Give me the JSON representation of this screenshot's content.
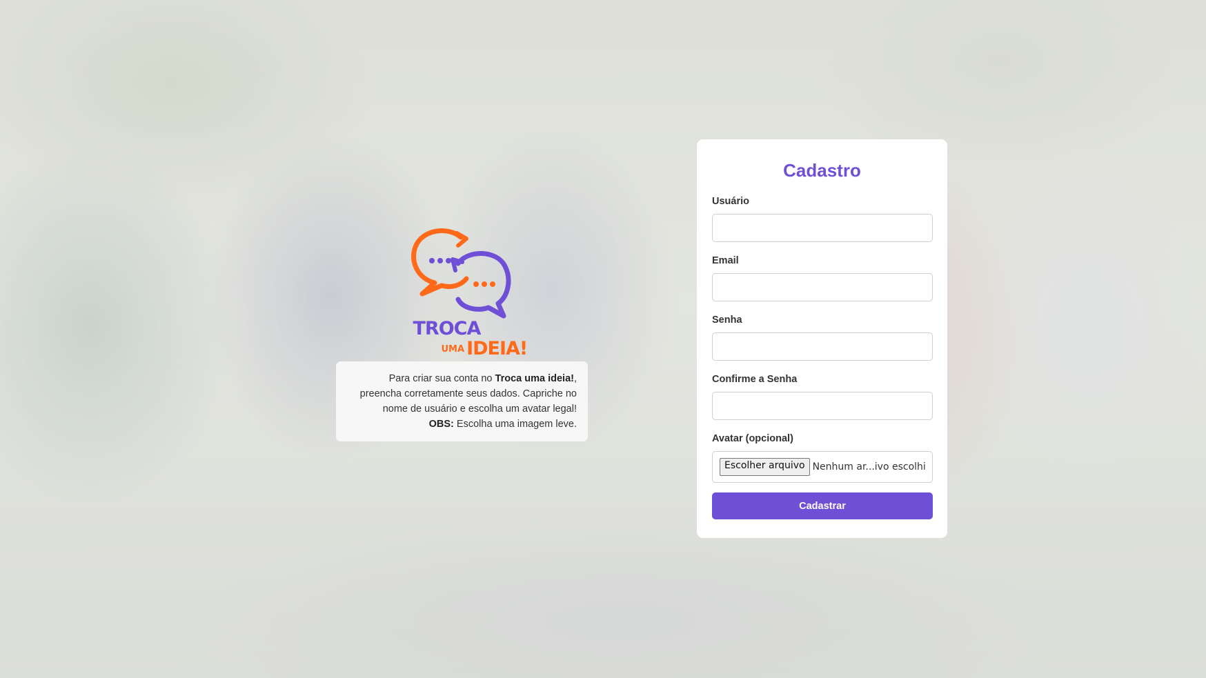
{
  "brand": {
    "logo_word_1": "TROCA",
    "logo_word_2": "UMA",
    "logo_word_3": "IDEIA!",
    "colors": {
      "primary": "#6f4fd6",
      "accent": "#ff6a1a"
    }
  },
  "info": {
    "line1_pre": "Para criar sua conta no ",
    "line1_bold": "Troca uma ideia!",
    "line1_post": ", preencha corretamente seus dados. Capriche no nome de usuário e escolha um avatar legal!",
    "obs_label": "OBS:",
    "obs_text": " Escolha uma imagem leve."
  },
  "form": {
    "title": "Cadastro",
    "fields": [
      {
        "label": "Usuário",
        "value": "",
        "type": "text"
      },
      {
        "label": "Email",
        "value": "",
        "type": "email"
      },
      {
        "label": "Senha",
        "value": "",
        "type": "password"
      },
      {
        "label": "Confirme a Senha",
        "value": "",
        "type": "password"
      }
    ],
    "avatar": {
      "label": "Avatar (opcional)",
      "button_label": "Escolher arquivo",
      "status": "Nenhum ar...ivo escolhido"
    },
    "submit_label": "Cadastrar"
  }
}
